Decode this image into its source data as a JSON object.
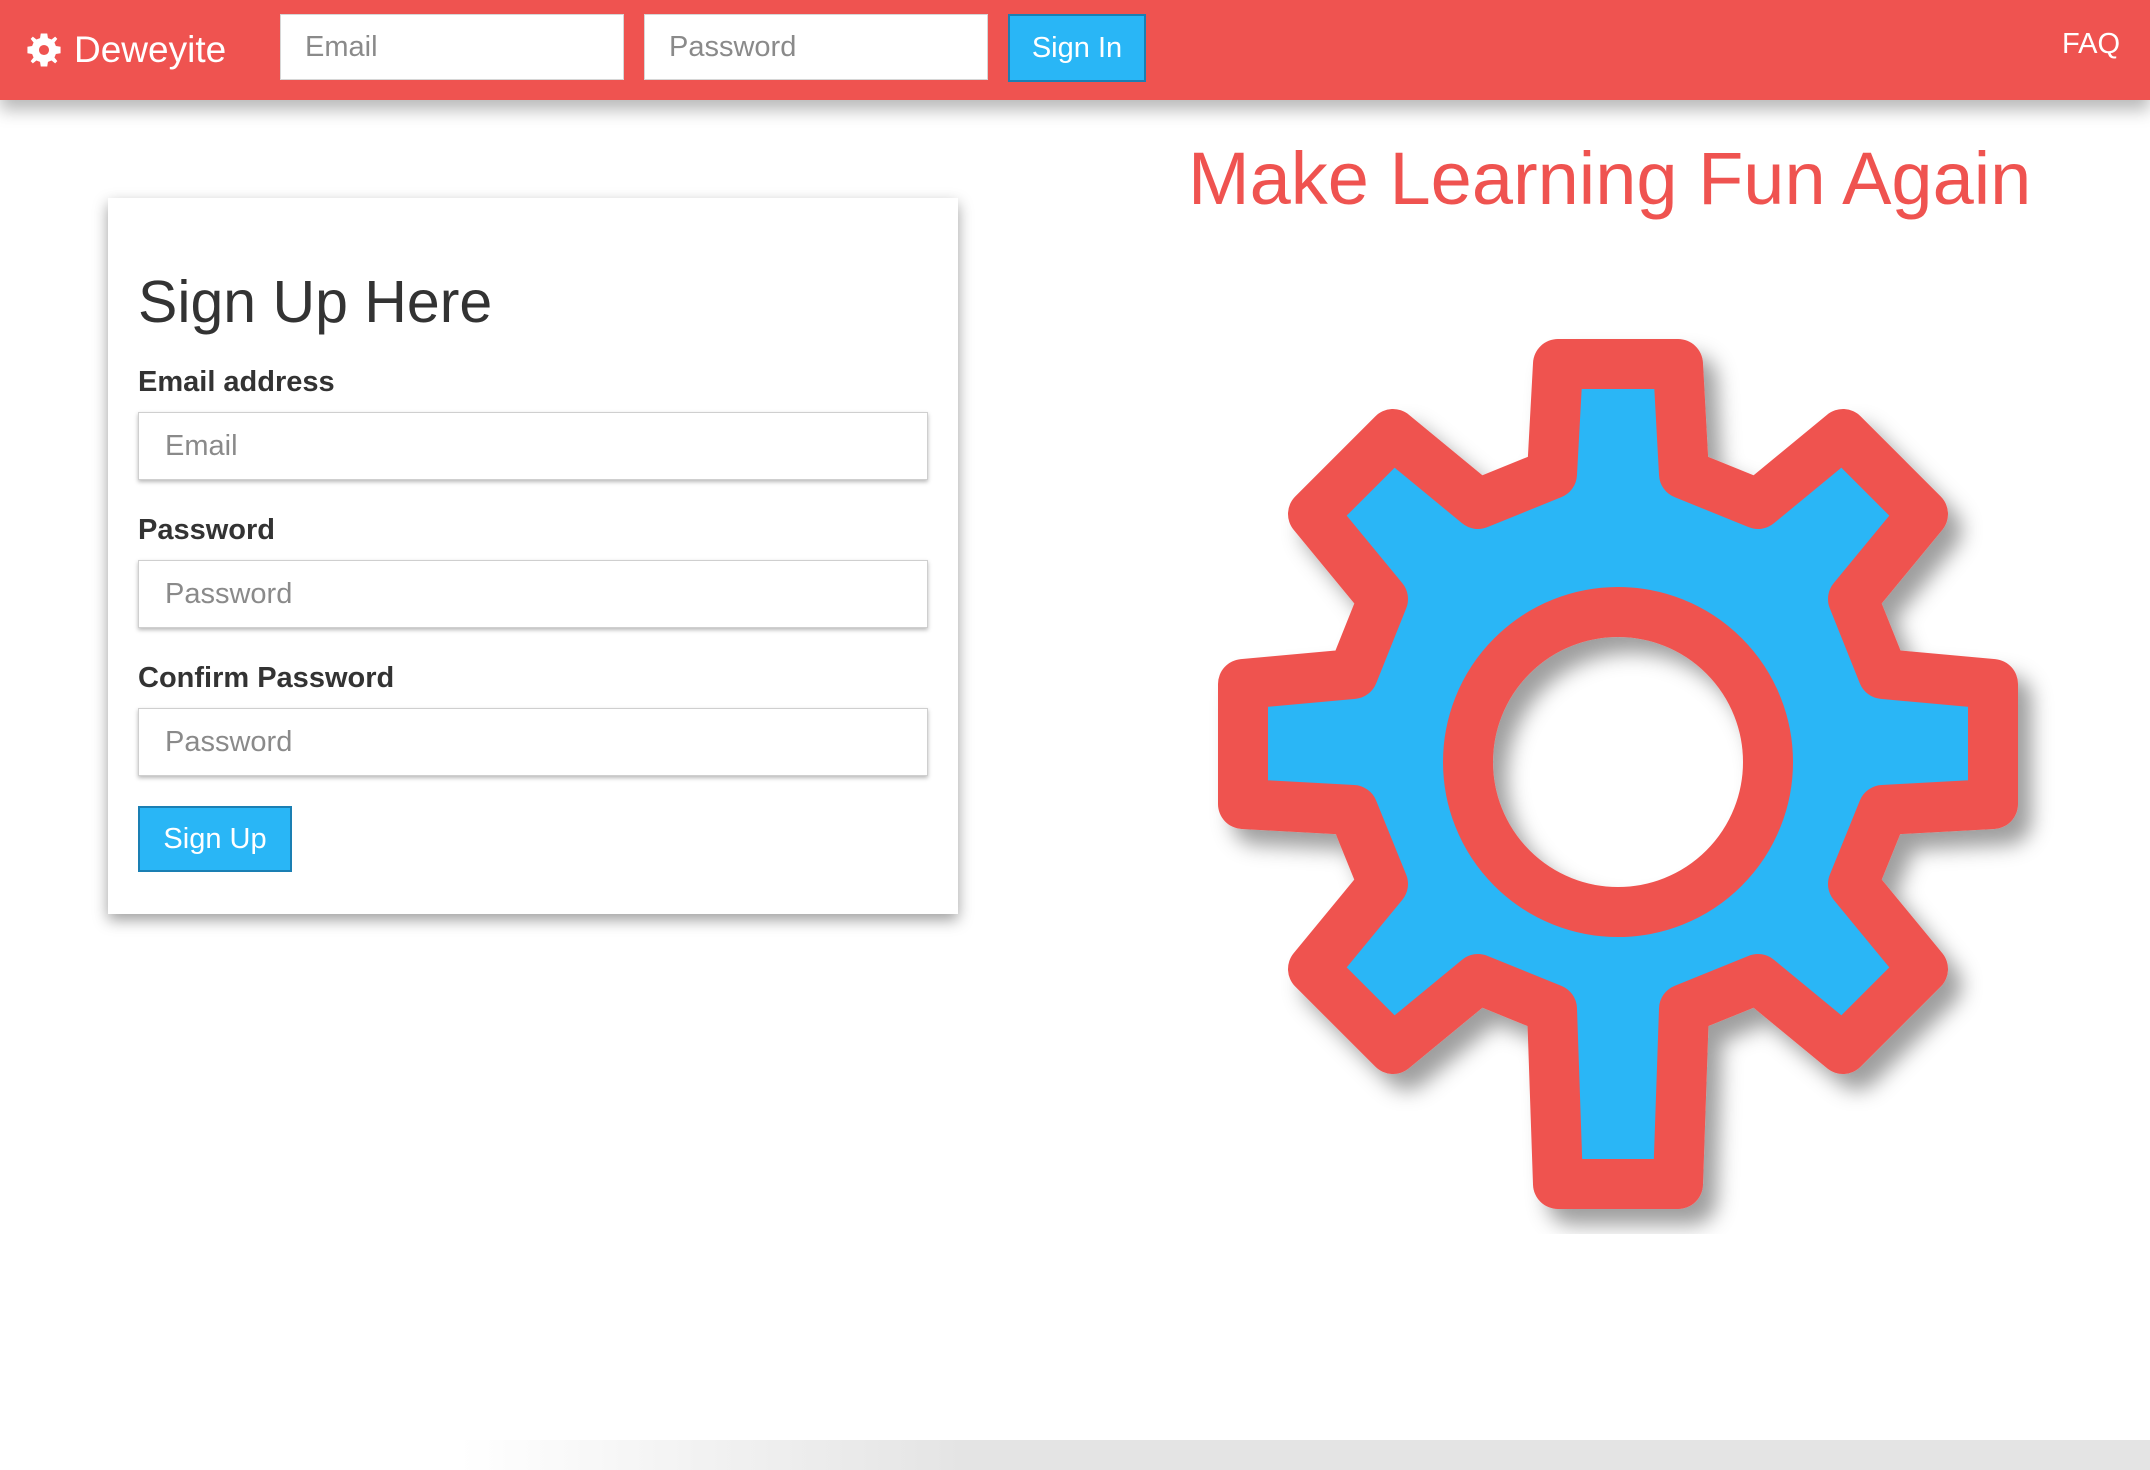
{
  "navbar": {
    "brand": "Deweyite",
    "brand_icon": "gear-icon",
    "email_placeholder": "Email",
    "password_placeholder": "Password",
    "signin_label": "Sign In",
    "faq_label": "FAQ"
  },
  "signup": {
    "title": "Sign Up Here",
    "email_label": "Email address",
    "email_placeholder": "Email",
    "password_label": "Password",
    "password_placeholder": "Password",
    "confirm_label": "Confirm Password",
    "confirm_placeholder": "Password",
    "submit_label": "Sign Up"
  },
  "hero": {
    "tagline": "Make Learning Fun Again",
    "illustration_icon": "gear-icon"
  },
  "colors": {
    "primary_red": "#ef5350",
    "accent_blue": "#29b6f6",
    "text_dark": "#333333"
  }
}
